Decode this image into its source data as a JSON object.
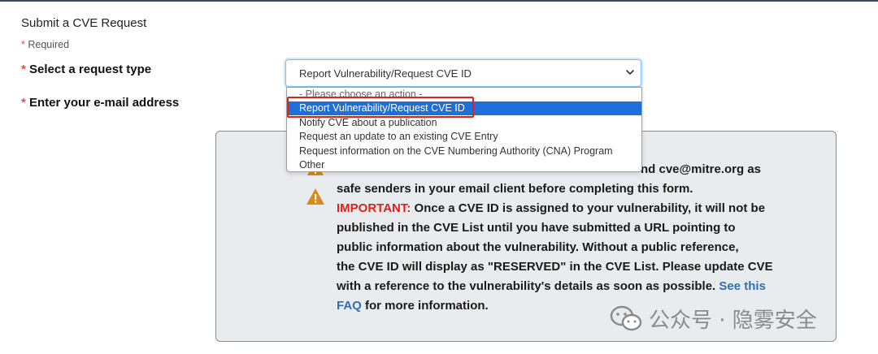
{
  "form": {
    "title": "Submit a CVE Request",
    "required_star": "*",
    "required_note": "Required",
    "request_type_label": "Select a request type",
    "email_label": "Enter your e-mail address"
  },
  "select": {
    "current_value": "Report Vulnerability/Request CVE ID",
    "options": [
      "- Please choose an action -",
      "Report Vulnerability/Request CVE ID",
      "Notify CVE about a publication",
      "Request an update to an existing CVE Entry",
      "Request information on the CVE Numbering Authority (CNA) Program",
      "Other"
    ],
    "highlighted_index": 1
  },
  "notice": {
    "line1_visible": "nd cve@mitre.org as",
    "line2": "safe senders in your email client before completing this form.",
    "important_label": "IMPORTANT:",
    "line3_rest": " Once a CVE ID is assigned to your vulnerability, it will not be",
    "line4": "published in the CVE List until you have submitted a URL pointing to",
    "line5": "public information about the vulnerability. Without a public reference,",
    "line6": "the CVE ID will display as \"RESERVED\" in the CVE List. Please update CVE",
    "line7_pre": "with a reference to the vulnerability's details as soon as possible. ",
    "link_see_this": "See this",
    "link_faq": "FAQ",
    "line8_post": " for more information."
  },
  "watermark": {
    "text": "公众号 · 隐雾安全"
  },
  "colors": {
    "required": "#d9534f",
    "important": "#e0201b",
    "link": "#2f6fb2",
    "selected_option": "#1e6fd9",
    "warning_icon": "#d98a1a"
  }
}
